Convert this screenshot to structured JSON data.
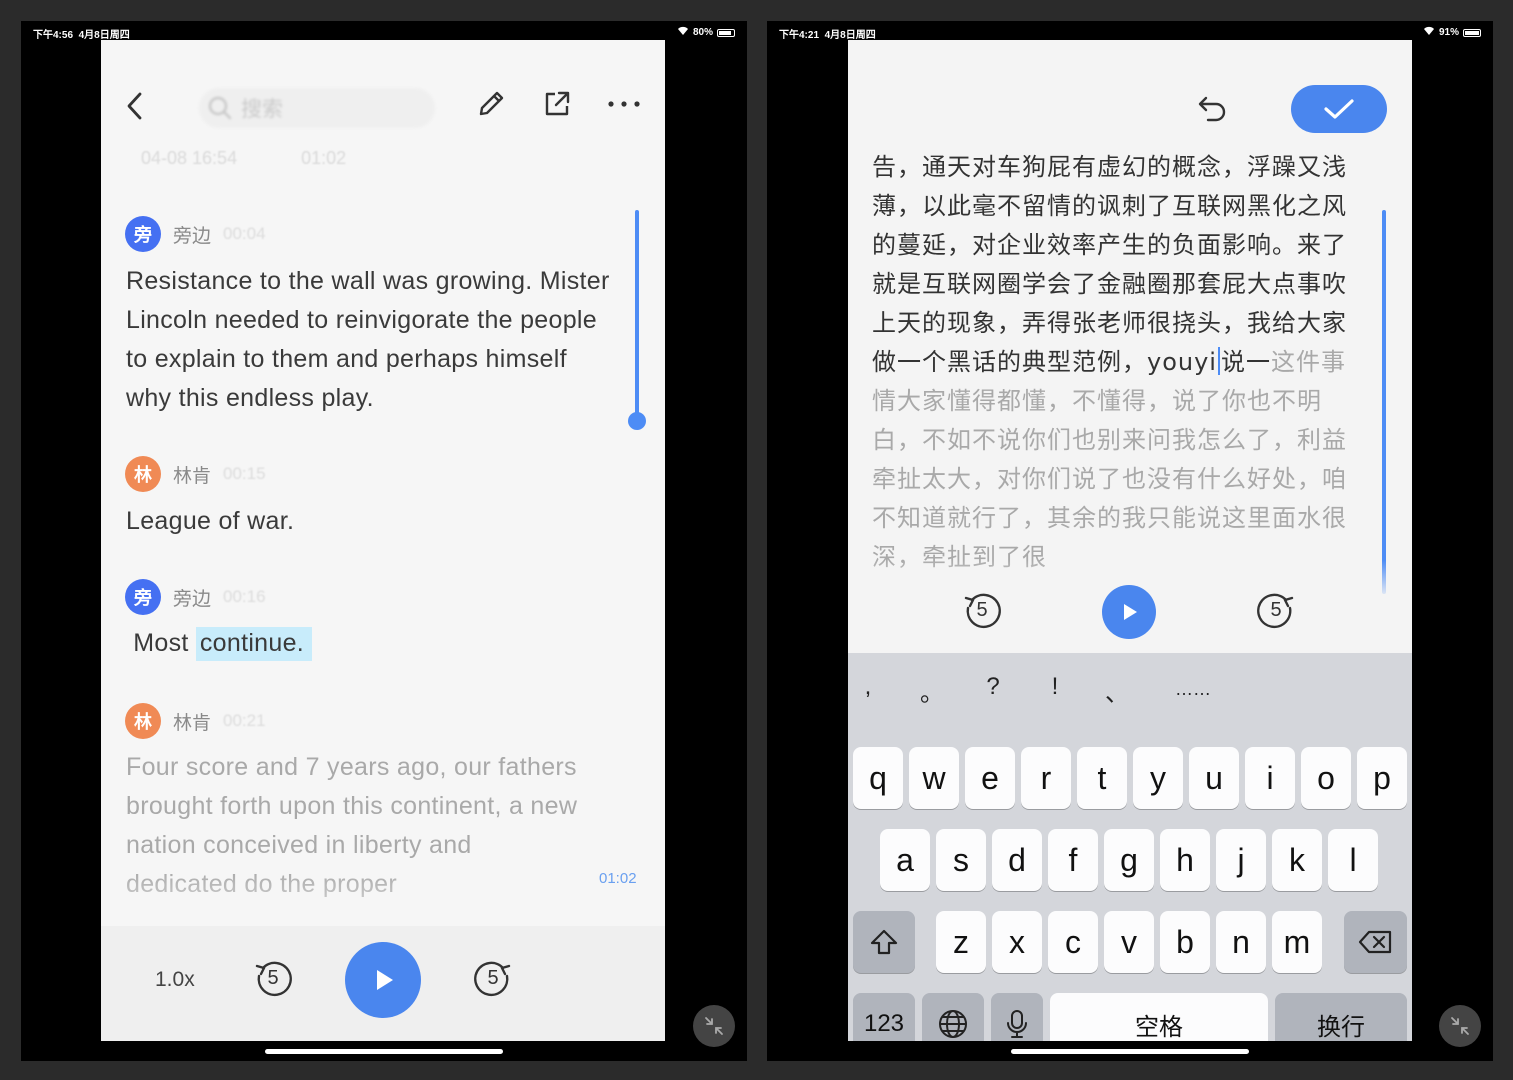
{
  "left": {
    "status": {
      "time": "下午4:56",
      "date": "4月8日周四",
      "battery": "80%"
    },
    "search": {
      "placeholder": "搜索"
    },
    "meta": {
      "datetime": "04-08 16:54",
      "duration": "01:02"
    },
    "segments": [
      {
        "speaker": "旁边",
        "avatar": "旁",
        "color": "#4570f2",
        "time": "00:04",
        "text": " Resistance to the wall was growing. Mister Lincoln needed to reinvigorate the people to explain to them and perhaps himself why this endless play."
      },
      {
        "speaker": "林肯",
        "avatar": "林",
        "color": "#f08a55",
        "time": "00:15",
        "text": " League of war."
      },
      {
        "speaker": "旁边",
        "avatar": "旁",
        "color": "#4570f2",
        "time": "00:16",
        "text_plain": " Most ",
        "text_highlight": "continue."
      },
      {
        "speaker": "林肯",
        "avatar": "林",
        "color": "#f08a55",
        "time": "00:21",
        "text": " Four score and 7 years ago, our fathers brought forth upon this continent, a new nation conceived in liberty and dedicated do the proper"
      }
    ],
    "scroll_time": "01:02",
    "player": {
      "speed": "1.0x",
      "skip_back": "5",
      "skip_forward": "5"
    }
  },
  "right": {
    "status": {
      "time": "下午4:21",
      "date": "4月8日周四",
      "battery": "91%"
    },
    "text_dark": "告，通天对车狗屁有虚幻的概念，浮躁又浅薄，以此毫不留情的讽刺了互联网黑化之风的蔓延，对企业效率产生的负面影响。来了就是互联网圈学会了金融圈那套屁大点事吹上天的现象，弄得张老师很挠头，我给大家做一个黑话的典型范例，youyi",
    "text_after_cursor": "说一",
    "text_grey": "这件事情大家懂得都懂，不懂得，说了你也不明白，不如不说你们也别来问我怎么了，利益牵扯太大，对你们说了也没有什么好处，咱不知道就行了，其余的我只能说这里面水很深，牵扯到了很",
    "player": {
      "skip_back": "5",
      "skip_forward": "5"
    },
    "keyboard": {
      "punct": [
        ",",
        "。",
        "?",
        "!",
        "、",
        "……"
      ],
      "row1": [
        "q",
        "w",
        "e",
        "r",
        "t",
        "y",
        "u",
        "i",
        "o",
        "p"
      ],
      "row2": [
        "a",
        "s",
        "d",
        "f",
        "g",
        "h",
        "j",
        "k",
        "l"
      ],
      "row3": [
        "z",
        "x",
        "c",
        "v",
        "b",
        "n",
        "m"
      ],
      "numbers_label": "123",
      "space_label": "空格",
      "return_label": "换行"
    }
  },
  "colors": {
    "accent": "#4a86ee",
    "blue_avatar": "#4570f2",
    "orange_avatar": "#f08a55",
    "highlight": "#c8ecfb"
  }
}
